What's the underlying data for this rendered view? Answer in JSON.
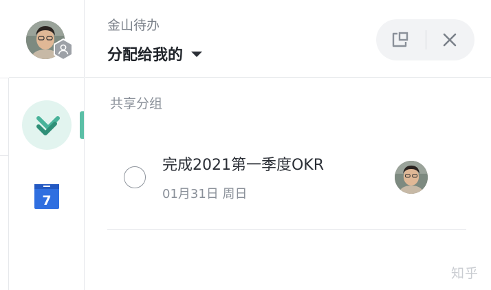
{
  "app": {
    "name": "金山待办"
  },
  "header": {
    "view_title": "分配给我的"
  },
  "group": {
    "title": "共享分组"
  },
  "task": {
    "title": "完成2021第一季度OKR",
    "due": "01月31日 周日"
  },
  "calendar": {
    "day": "7"
  },
  "watermark": "知乎",
  "colors": {
    "accent": "#5bbfa6",
    "active_bg": "#e2f4ef",
    "calendar_blue": "#2f6fe0"
  }
}
